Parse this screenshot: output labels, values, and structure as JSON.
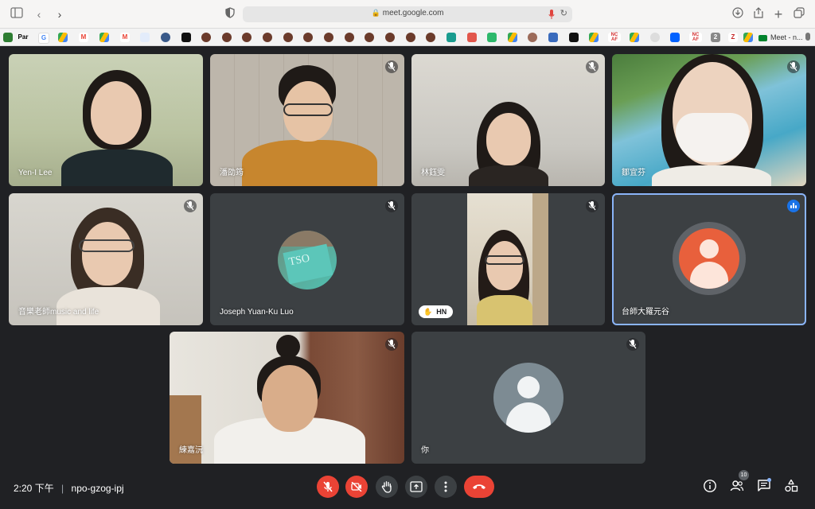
{
  "browser": {
    "url": "meet.google.com",
    "bookmark_labels": [
      "Par",
      "NC AF",
      "NC AF",
      "2",
      "Z"
    ],
    "meet_tab_label": "Meet - n..."
  },
  "participants": [
    {
      "name": "Yen-I Lee",
      "muted": false
    },
    {
      "name": "潘劭筠",
      "muted": true
    },
    {
      "name": "林鈺雯",
      "muted": true
    },
    {
      "name": "鄒宜芬",
      "muted": true
    },
    {
      "name": "音樂老師music and life",
      "muted": true
    },
    {
      "name": "Joseph Yuan-Ku Luo",
      "muted": true,
      "avatar_text": "TSO"
    },
    {
      "name": "HN",
      "muted": true,
      "hand_raised": true
    },
    {
      "name": "台師大羅元谷",
      "muted": false,
      "speaking": true
    },
    {
      "name": "練嘉沅",
      "muted": true
    },
    {
      "name": "你",
      "muted": true
    }
  ],
  "meeting": {
    "time": "2:20 下午",
    "code": "npo-gzog-ipj",
    "participant_count": "10"
  },
  "colors": {
    "background": "#202124",
    "tile": "#3c4043",
    "danger": "#ea4335",
    "speaking": "#8ab4f8",
    "avatar_orange": "#e8603c"
  }
}
